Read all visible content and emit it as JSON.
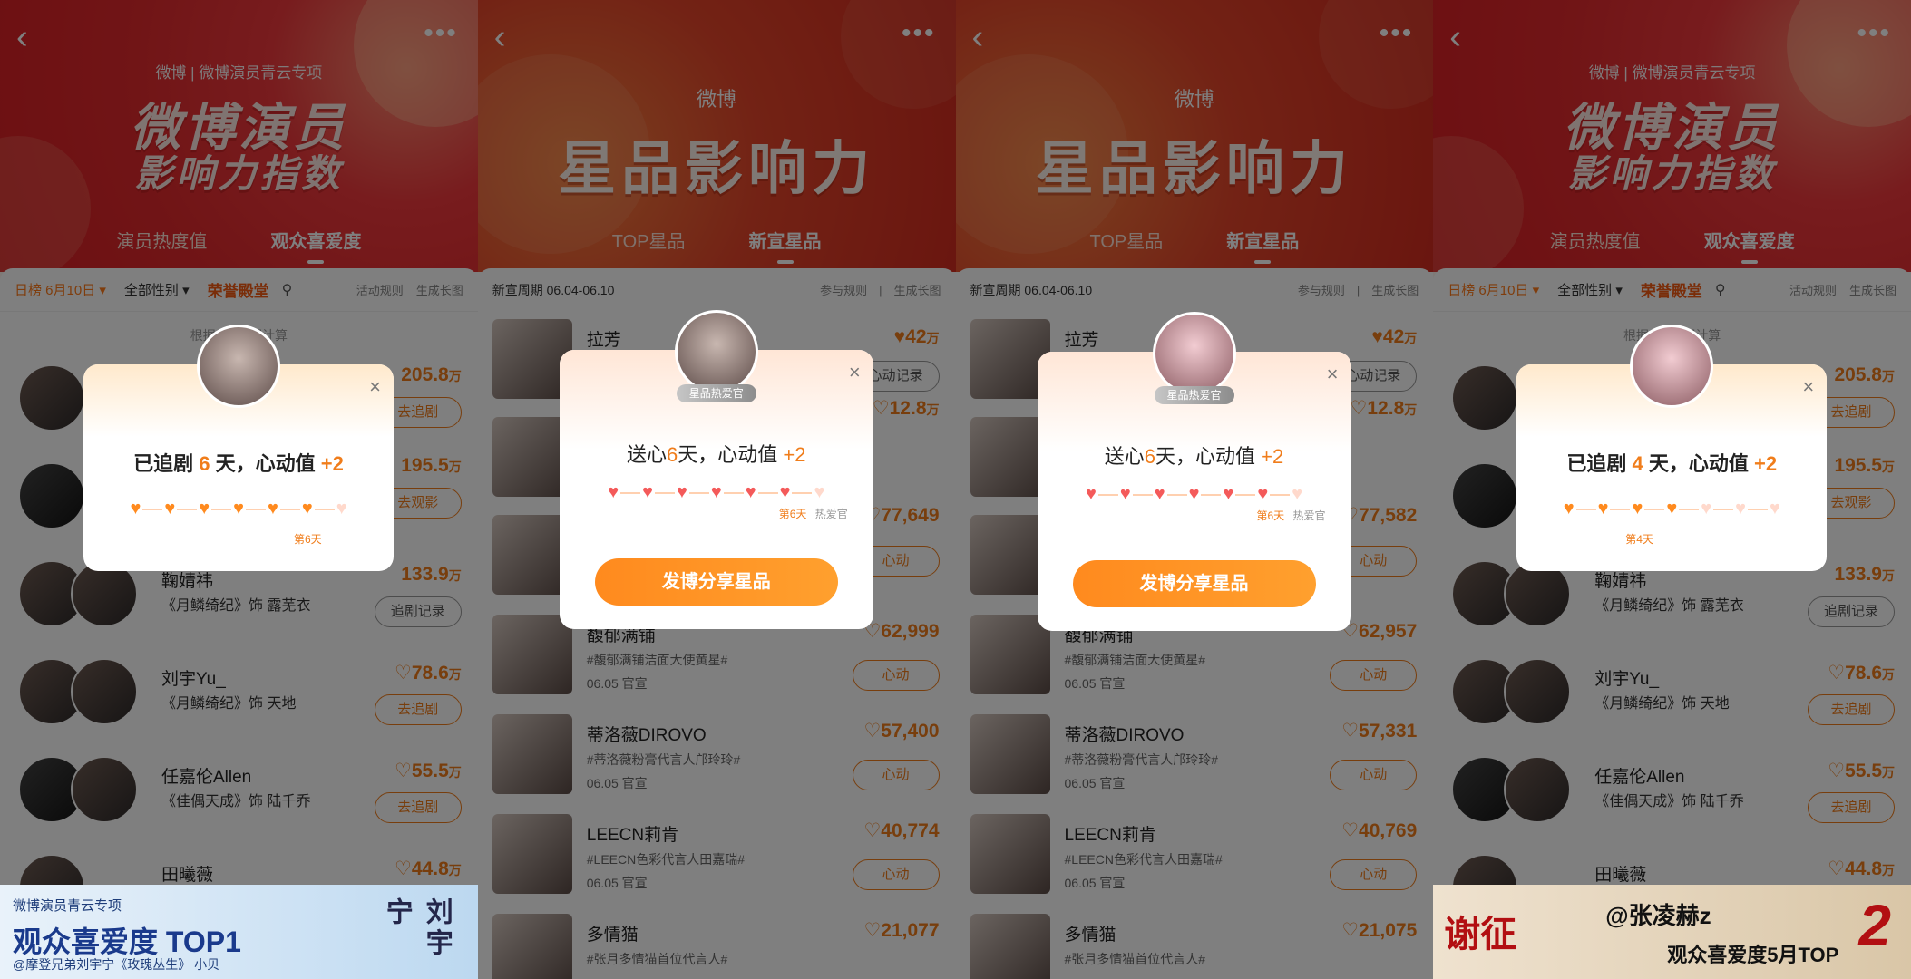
{
  "common": {
    "back_glyph": "‹",
    "more_glyph": "•••",
    "close_glyph": "×",
    "heart_glyph": "♥",
    "heart_outline_glyph": "♡"
  },
  "panel1": {
    "brand": "微博 | 微博演员青云专项",
    "title1": "微博演员",
    "title2": "影响力指数",
    "tabs": [
      "演员热度值",
      "观众喜爱度"
    ],
    "filters": {
      "date": "日榜 6月10日 ▾",
      "gender": "全部性别 ▾",
      "hall": "荣誉殿堂",
      "rules": "活动规则",
      "long": "生成长图"
    },
    "note": "根据 20… 据计算",
    "rows": [
      {
        "score": "205.8",
        "unit": "万",
        "btn": "去追剧"
      },
      {
        "score": "195.5",
        "unit": "万",
        "btn": "去观影"
      },
      {
        "name": "鞠婧祎",
        "role": "《月鳞绮纪》饰 露芜衣",
        "score": "133.9",
        "unit": "万",
        "btn": "追剧记录"
      },
      {
        "name": "刘宇Yu_",
        "role": "《月鳞绮纪》饰 天地",
        "score": "78.6",
        "unit": "万",
        "btn": "去追剧"
      },
      {
        "name": "任嘉伦Allen",
        "role": "《佳偶天成》饰 陆千乔",
        "score": "55.5",
        "unit": "万",
        "btn": "去追剧"
      },
      {
        "name": "田曦薇",
        "score": "44.8",
        "unit": "万"
      }
    ],
    "popup": {
      "prefix": "已追剧 ",
      "days": "6",
      "suffix": " 天，心动值 ",
      "plus": "+2",
      "day_label": "第6天",
      "filled": 6
    },
    "banner": {
      "top": "微博演员青云专项",
      "big": "观众喜爱度 TOP1",
      "credit": "@摩登兄弟刘宇宁《玫瑰丛生》 小贝",
      "side": "刘宇宁"
    }
  },
  "panel2": {
    "brand": "微博",
    "title": "星品影响力",
    "tabs": [
      "TOP星品",
      "新宣星品"
    ],
    "period": "新宣周期 06.04-06.10",
    "rules": "参与规则",
    "long": "生成长图",
    "rows": [
      {
        "name": "拉芳",
        "score": "42",
        "unit": "万"
      },
      {
        "score": "12.8",
        "unit": "万",
        "btn": "心动记录"
      },
      {
        "score": "77,649",
        "btn": "心动"
      },
      {
        "name": "馥郁满铺",
        "tag": "#馥郁满铺洁面大使黄星#",
        "date": "06.05 官宣",
        "score": "62,999",
        "btn": "心动"
      },
      {
        "name": "蒂洛薇DIROVO",
        "tag": "#蒂洛薇粉膏代言人邝玲玲#",
        "date": "06.05 官宣",
        "score": "57,400",
        "btn": "心动"
      },
      {
        "name": "LEECN莉肯",
        "tag": "#LEECN色彩代言人田嘉瑞#",
        "date": "06.05 官宣",
        "score": "40,774",
        "btn": "心动"
      },
      {
        "name": "多情猫",
        "tag": "#张月多情猫首位代言人#",
        "score": "21,077"
      }
    ],
    "popup": {
      "badge": "星品热爱官",
      "prefix": "送心",
      "days": "6",
      "suffix": "天，心动值 ",
      "plus": "+2",
      "day_label": "第6天",
      "end_label": "热爱官",
      "filled": 6,
      "button": "发博分享星品"
    }
  },
  "panel3": {
    "brand": "微博",
    "title": "星品影响力",
    "tabs": [
      "TOP星品",
      "新宣星品"
    ],
    "period": "新宣周期 06.04-06.10",
    "rules": "参与规则",
    "long": "生成长图",
    "rows": [
      {
        "name": "拉芳",
        "score": "42",
        "unit": "万"
      },
      {
        "score": "12.8",
        "unit": "万",
        "btn": "心动记录"
      },
      {
        "score": "77,582",
        "btn": "心动"
      },
      {
        "name": "馥郁满铺",
        "tag": "#馥郁满铺洁面大使黄星#",
        "date": "06.05 官宣",
        "score": "62,957",
        "btn": "心动"
      },
      {
        "name": "蒂洛薇DIROVO",
        "tag": "#蒂洛薇粉膏代言人邝玲玲#",
        "date": "06.05 官宣",
        "score": "57,331",
        "btn": "心动"
      },
      {
        "name": "LEECN莉肯",
        "tag": "#LEECN色彩代言人田嘉瑞#",
        "date": "06.05 官宣",
        "score": "40,769",
        "btn": "心动"
      },
      {
        "name": "多情猫",
        "tag": "#张月多情猫首位代言人#",
        "score": "21,075"
      }
    ],
    "popup": {
      "badge": "星品热爱官",
      "prefix": "送心",
      "days": "6",
      "suffix": "天，心动值 ",
      "plus": "+2",
      "day_label": "第6天",
      "end_label": "热爱官",
      "filled": 6,
      "button": "发博分享星品"
    }
  },
  "panel4": {
    "brand": "微博 | 微博演员青云专项",
    "title1": "微博演员",
    "title2": "影响力指数",
    "tabs": [
      "演员热度值",
      "观众喜爱度"
    ],
    "filters": {
      "date": "日榜 6月10日 ▾",
      "gender": "全部性别 ▾",
      "hall": "荣誉殿堂",
      "rules": "活动规则",
      "long": "生成长图"
    },
    "note": "根据 20… 据计算",
    "rows": [
      {
        "score": "205.8",
        "unit": "万",
        "btn": "去追剧"
      },
      {
        "score": "195.5",
        "unit": "万",
        "btn": "去观影"
      },
      {
        "name": "鞠婧祎",
        "role": "《月鳞绮纪》饰 露芜衣",
        "score": "133.9",
        "unit": "万",
        "btn": "追剧记录"
      },
      {
        "name": "刘宇Yu_",
        "role": "《月鳞绮纪》饰 天地",
        "score": "78.6",
        "unit": "万",
        "btn": "去追剧"
      },
      {
        "name": "任嘉伦Allen",
        "role": "《佳偶天成》饰 陆千乔",
        "score": "55.5",
        "unit": "万",
        "btn": "去追剧"
      },
      {
        "name": "田曦薇",
        "score": "44.8",
        "unit": "万"
      }
    ],
    "popup": {
      "prefix": "已追剧 ",
      "days": "4",
      "suffix": " 天，心动值 ",
      "plus": "+2",
      "day_label": "第4天",
      "filled": 4
    },
    "banner": {
      "a": "谢征",
      "b": "@张凌赫z",
      "c": "观众喜爱度5月TOP",
      "d": "2"
    }
  }
}
